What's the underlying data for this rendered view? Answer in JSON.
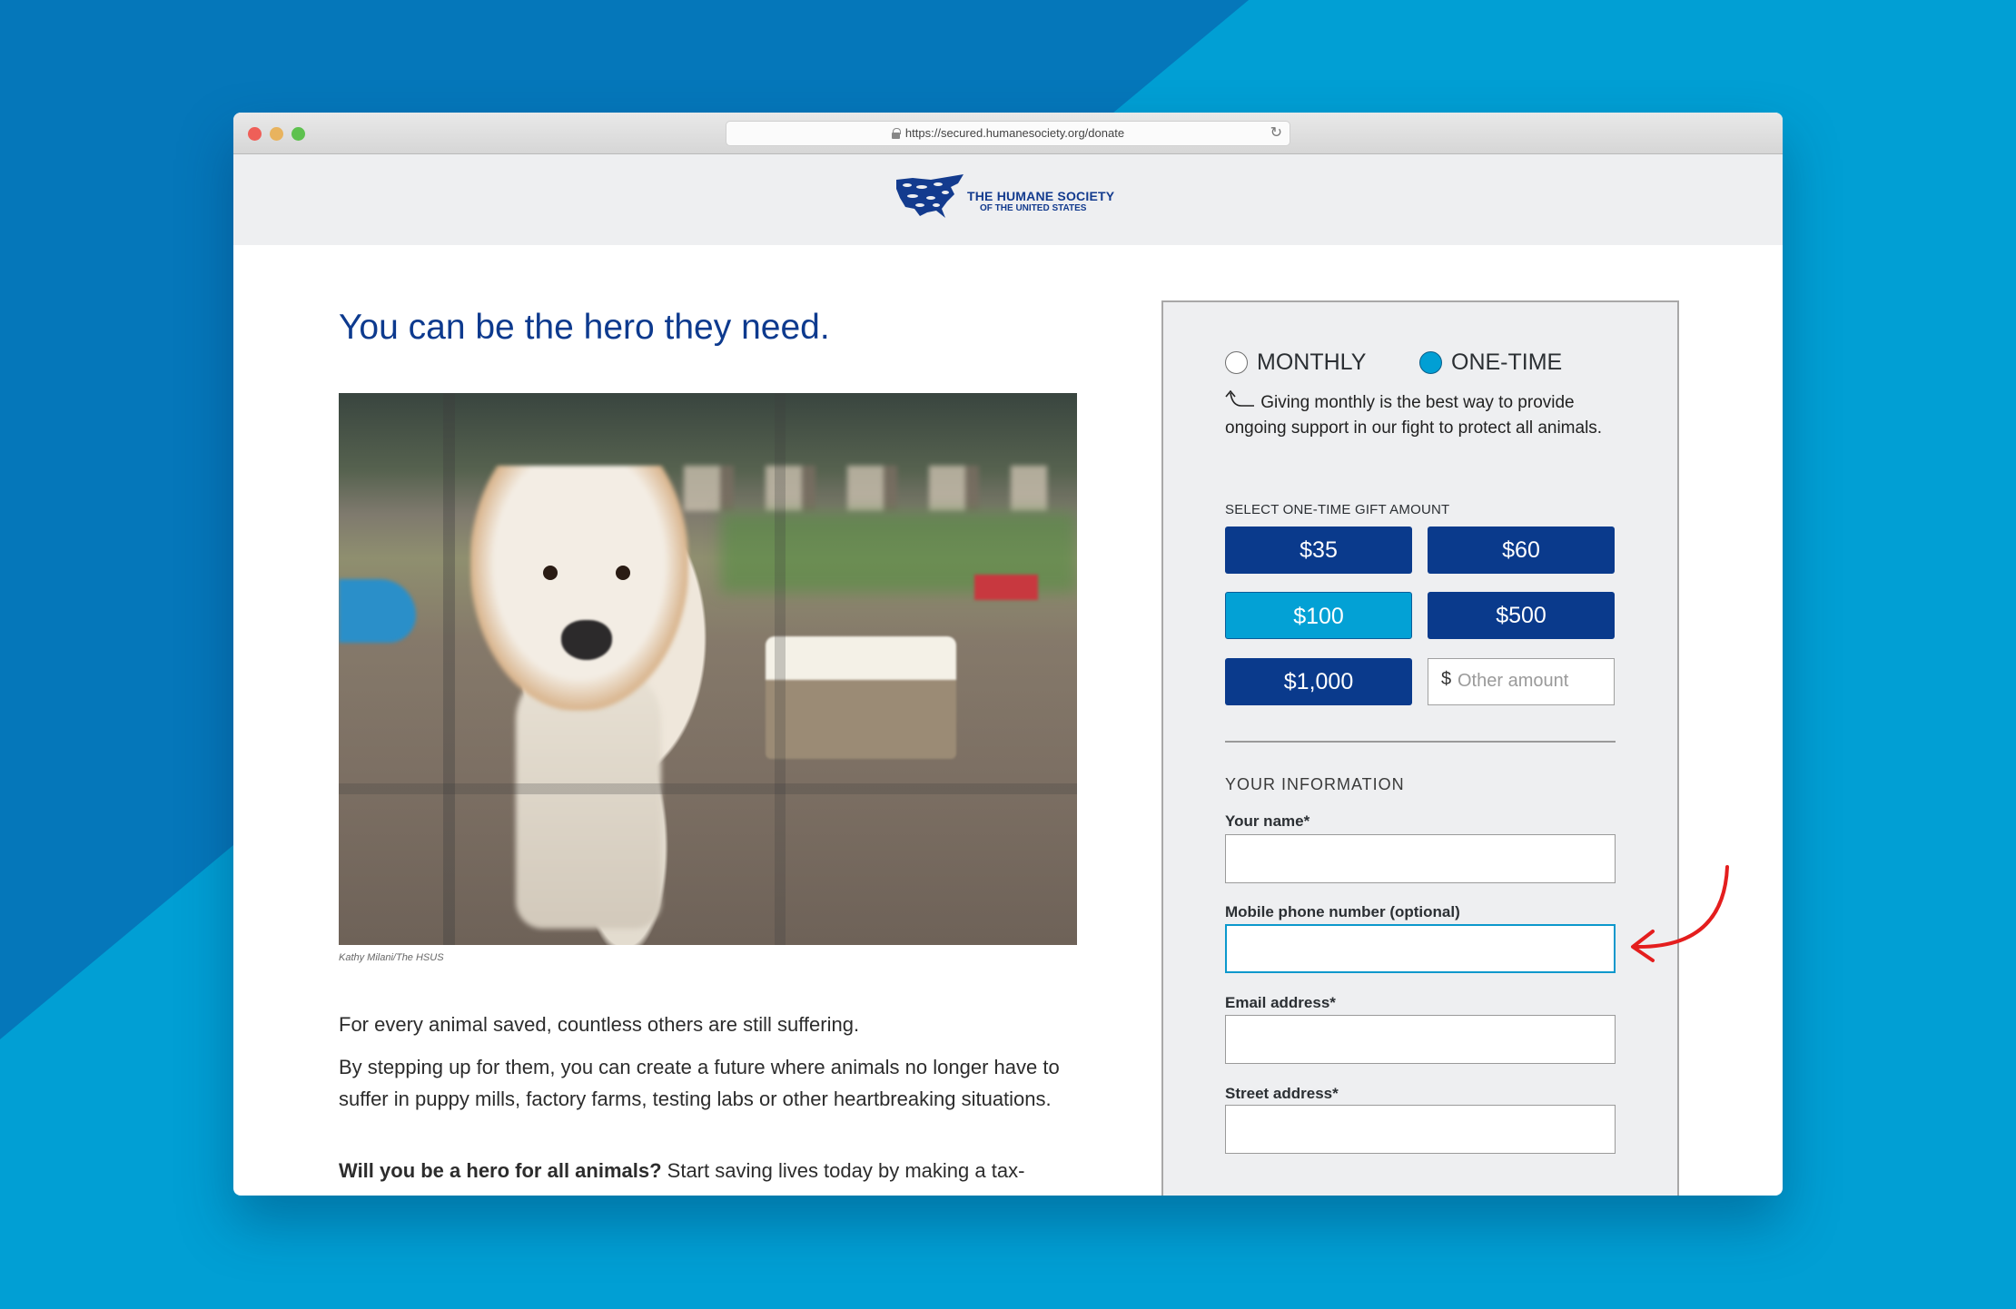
{
  "browser": {
    "url": "https://secured.humanesociety.org/donate",
    "icons": {
      "lock": "lock-icon",
      "reload": "reload-icon"
    }
  },
  "logo": {
    "line1": "THE HUMANE SOCIETY",
    "line2": "OF THE UNITED STATES"
  },
  "main": {
    "headline": "You can be the hero they need.",
    "photo_caption": "Kathy Milani/The HSUS",
    "paragraphs": [
      "For every animal saved, countless others are still suffering.",
      "By stepping up for them, you can create a future where animals no longer have to suffer in puppy mills, factory farms, testing labs or other heartbreaking situations."
    ],
    "closing_bold": "Will you be a hero for all animals?",
    "closing_rest": " Start saving lives today by making a tax-"
  },
  "form": {
    "frequency": {
      "monthly_label": "MONTHLY",
      "onetime_label": "ONE-TIME",
      "selected": "ONE-TIME"
    },
    "hint": "Giving monthly is the best way to provide ongoing support in our fight to protect all animals.",
    "gift_label": "SELECT ONE-TIME GIFT AMOUNT",
    "amounts": [
      "$35",
      "$60",
      "$100",
      "$500",
      "$1,000"
    ],
    "selected_amount": "$100",
    "other_amount": {
      "prefix": "$",
      "placeholder": "Other amount",
      "value": ""
    },
    "section_title": "YOUR INFORMATION",
    "fields": {
      "name": {
        "label": "Your name*",
        "value": ""
      },
      "phone": {
        "label": "Mobile phone number (optional)",
        "value": "",
        "focused": true
      },
      "email": {
        "label": "Email address*",
        "value": ""
      },
      "street": {
        "label": "Street address*",
        "value": ""
      }
    }
  },
  "annotation": {
    "arrow_color": "#e41e1e",
    "points_to": "Mobile phone number (optional)"
  },
  "colors": {
    "brand_navy": "#0a3a8c",
    "accent_cyan": "#03a1d5",
    "background_blue": "#019fd4",
    "background_dark_blue": "#0577ba",
    "panel_gray": "#eeeff1"
  }
}
